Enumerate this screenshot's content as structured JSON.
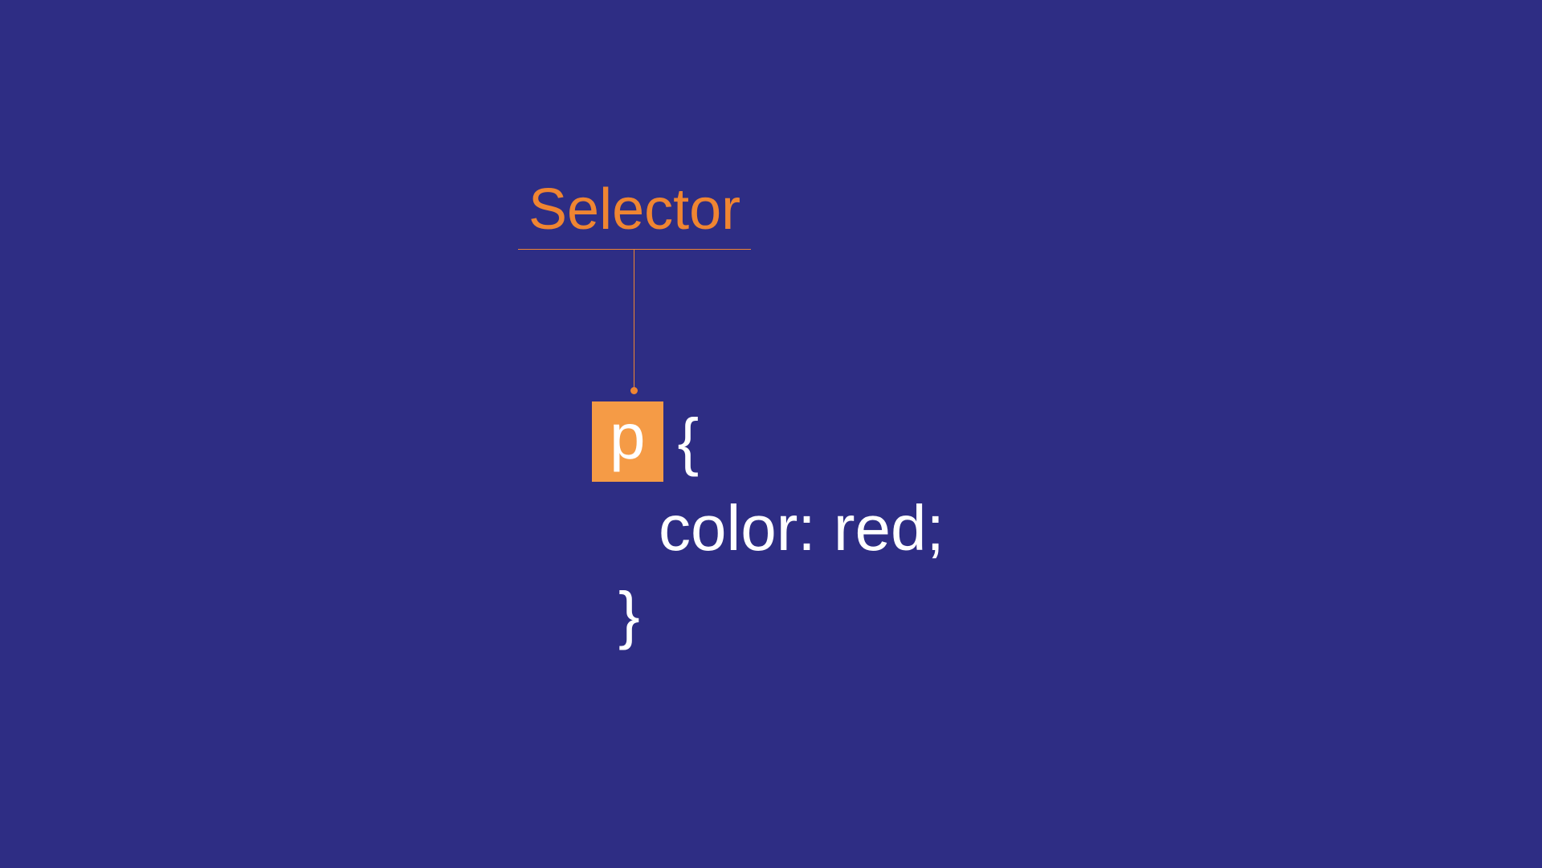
{
  "diagram": {
    "label": "Selector",
    "code": {
      "selector": "p",
      "brace_open": "{",
      "declaration": "color: red;",
      "brace_close": "}"
    }
  },
  "colors": {
    "background": "#2e2d84",
    "accent": "#ef8532",
    "highlight_box": "#f59b46",
    "text": "#ffffff"
  }
}
